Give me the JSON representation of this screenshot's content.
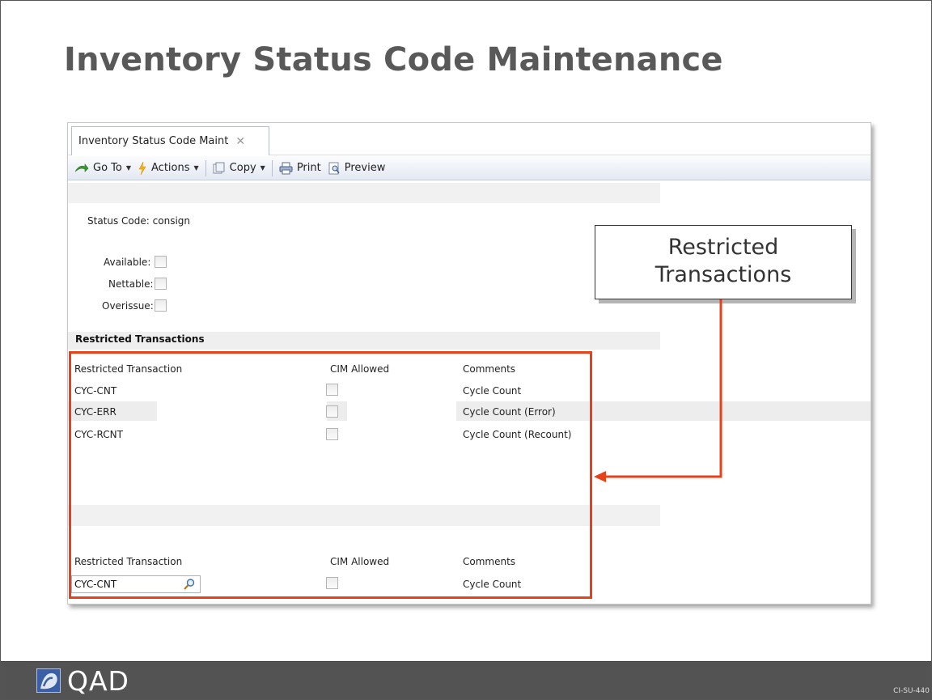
{
  "slide": {
    "title": "Inventory Status Code Maintenance",
    "slide_code": "CI-SU-440"
  },
  "app": {
    "tab_label": "Inventory Status Code Maint",
    "toolbar": {
      "goto": "Go To",
      "actions": "Actions",
      "copy": "Copy",
      "print": "Print",
      "preview": "Preview"
    },
    "status_code_label": "Status Code:",
    "status_code_value": "consign",
    "flags": [
      {
        "label": "Available:",
        "checked": false
      },
      {
        "label": "Nettable:",
        "checked": false
      },
      {
        "label": "Overissue:",
        "checked": false
      }
    ],
    "section_title": "Restricted Transactions",
    "grid": {
      "columns": [
        "Restricted Transaction",
        "CIM Allowed",
        "Comments"
      ],
      "rows": [
        {
          "transaction": "CYC-CNT",
          "cim_allowed": false,
          "comment": "Cycle Count"
        },
        {
          "transaction": "CYC-ERR",
          "cim_allowed": false,
          "comment": "Cycle Count (Error)"
        },
        {
          "transaction": "CYC-RCNT",
          "cim_allowed": false,
          "comment": "Cycle Count (Recount)"
        }
      ]
    },
    "detail": {
      "columns": [
        "Restricted Transaction",
        "CIM Allowed",
        "Comments"
      ],
      "transaction_value": "CYC-CNT",
      "cim_allowed": false,
      "comment": "Cycle Count"
    }
  },
  "callout": {
    "text": "Restricted Transactions",
    "highlight_color": "#e8411a"
  },
  "footer": {
    "logo_text": "QAD",
    "logo_color": "#3a5fa7"
  }
}
